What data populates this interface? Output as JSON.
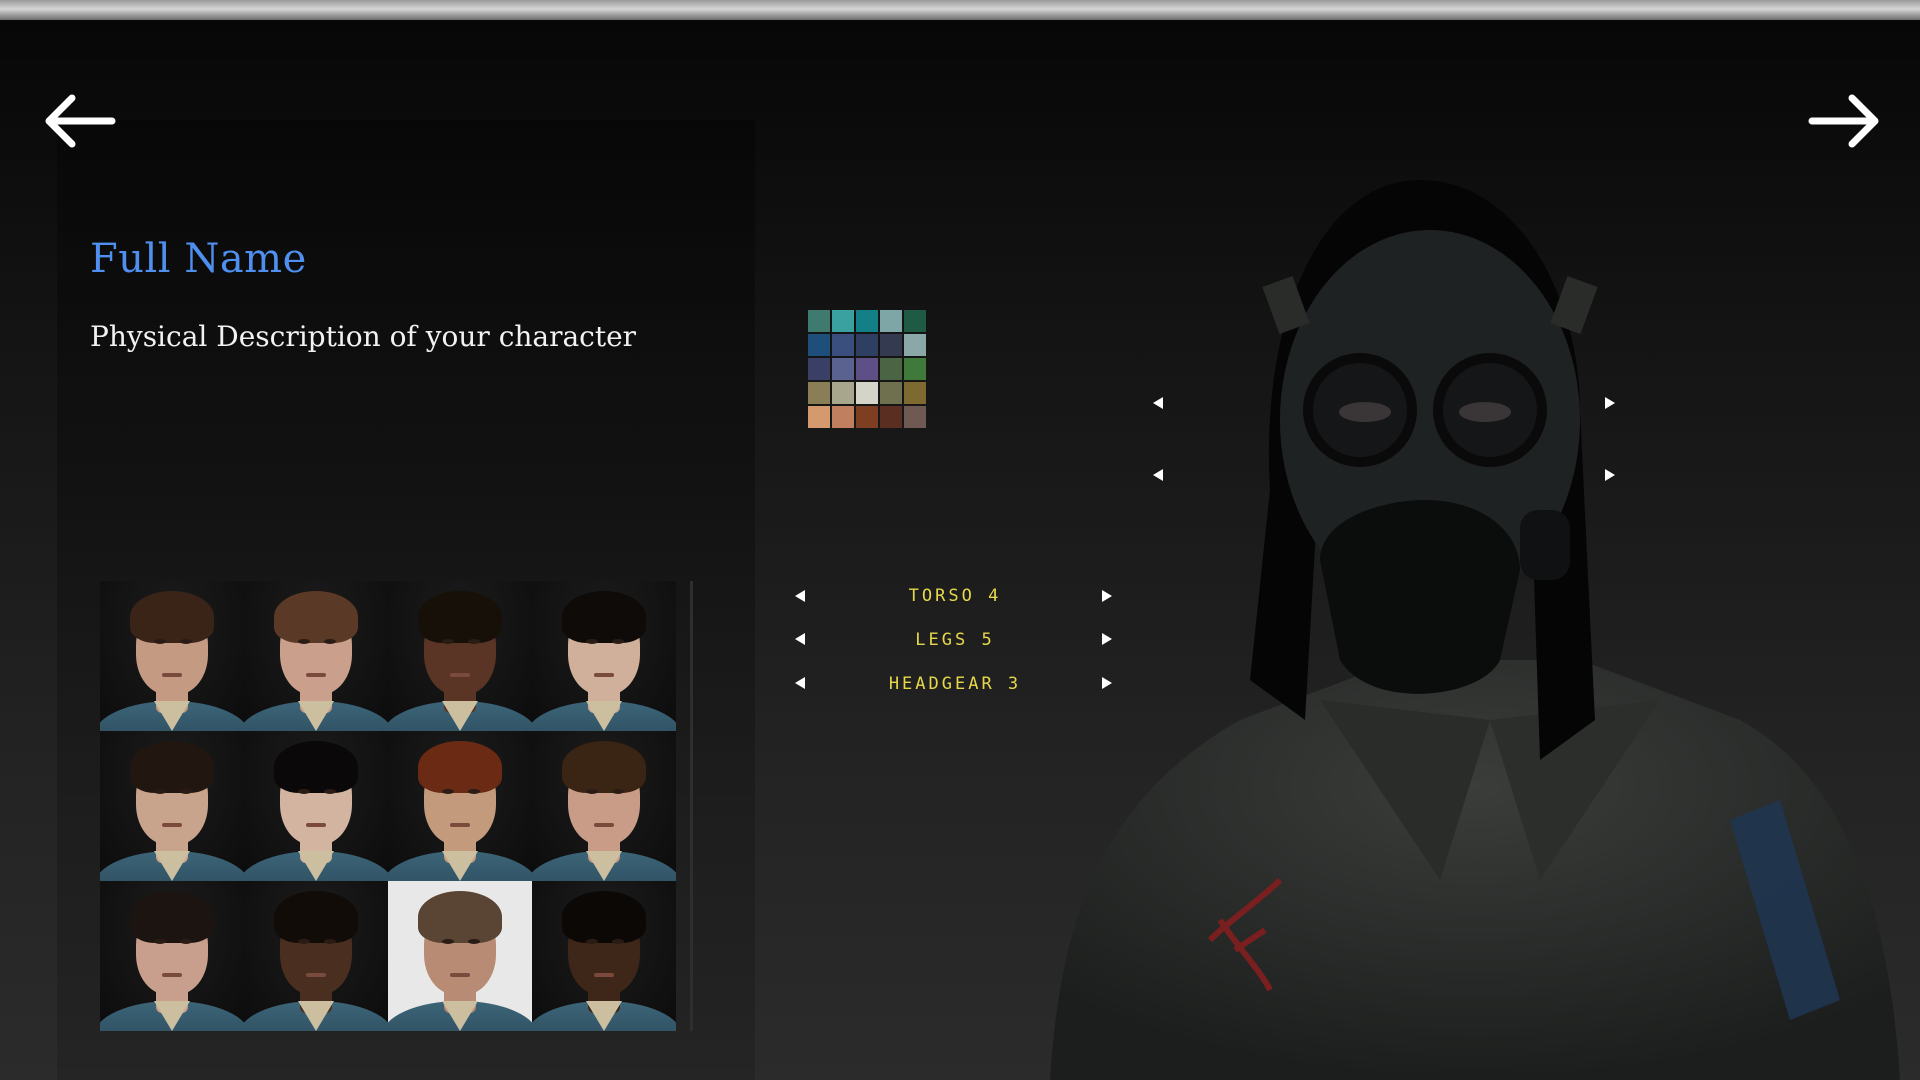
{
  "header": {
    "back_icon": "arrow-left-icon",
    "forward_icon": "arrow-right-icon"
  },
  "form": {
    "full_name": "Full Name",
    "description": "Physical Description of your character"
  },
  "faces": {
    "count": 12,
    "selected_index": 10
  },
  "palette": {
    "colors": [
      "#3f7a6e",
      "#3aa0a0",
      "#137f86",
      "#7fa6a6",
      "#1f5a44",
      "#1d4f7a",
      "#3a4f7e",
      "#2f3f62",
      "#343a50",
      "#8aa8a8",
      "#3a3f66",
      "#5a6290",
      "#5e4f86",
      "#4a6444",
      "#3f7a3a",
      "#8a7e56",
      "#a8a68c",
      "#d4d4c8",
      "#6e704e",
      "#7e6a30",
      "#d49a6e",
      "#c08060",
      "#7e3e22",
      "#5a2f22",
      "#6e5a52"
    ]
  },
  "outfit": {
    "rows": [
      {
        "label": "TORSO 4"
      },
      {
        "label": "LEGS 5"
      },
      {
        "label": "HEADGEAR 3"
      }
    ]
  }
}
